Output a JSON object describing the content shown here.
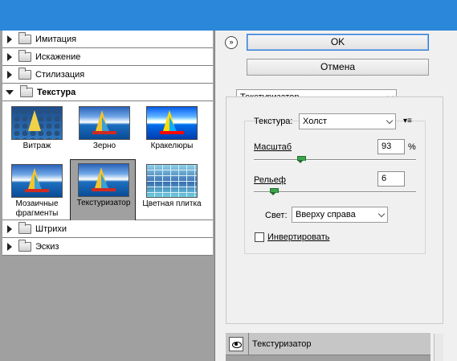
{
  "window": {
    "title_bar_color": "#2b87d9"
  },
  "filter_tree": {
    "categories_top": [
      {
        "label": "Имитация",
        "open": false
      },
      {
        "label": "Искажение",
        "open": false
      },
      {
        "label": "Стилизация",
        "open": false
      },
      {
        "label": "Текстура",
        "open": true
      }
    ],
    "thumbnails": [
      {
        "label": "Витраж",
        "icon": "stained-glass-thumbnail"
      },
      {
        "label": "Зерно",
        "icon": "grain-thumbnail"
      },
      {
        "label": "Кракелюры",
        "icon": "craquelure-thumbnail"
      },
      {
        "label": "Мозаичные фрагменты",
        "icon": "mosaic-tiles-thumbnail"
      },
      {
        "label": "Текстуризатор",
        "icon": "texturizer-thumbnail",
        "selected": true
      },
      {
        "label": "Цветная плитка",
        "icon": "patchwork-thumbnail"
      }
    ],
    "categories_bottom": [
      {
        "label": "Штрихи",
        "open": false
      },
      {
        "label": "Эскиз",
        "open": false
      }
    ]
  },
  "buttons": {
    "ok": "OK",
    "cancel": "Отмена",
    "help": "»"
  },
  "filter_select": {
    "value": "Текстуризатор"
  },
  "settings": {
    "texture_label": "Текстура:",
    "texture_value": "Холст",
    "scale_label": "Масштаб",
    "scale_value": "93",
    "scale_unit": "%",
    "scale_level_percent": 93,
    "relief_label": "Рельеф",
    "relief_value": "6",
    "relief_level_max": 50,
    "light_label": "Свет:",
    "light_value": "Вверху справа",
    "invert_label": "Инвертировать",
    "invert_checked": false
  },
  "layers": {
    "items": [
      {
        "name": "Текстуризатор",
        "visible": true
      }
    ]
  }
}
